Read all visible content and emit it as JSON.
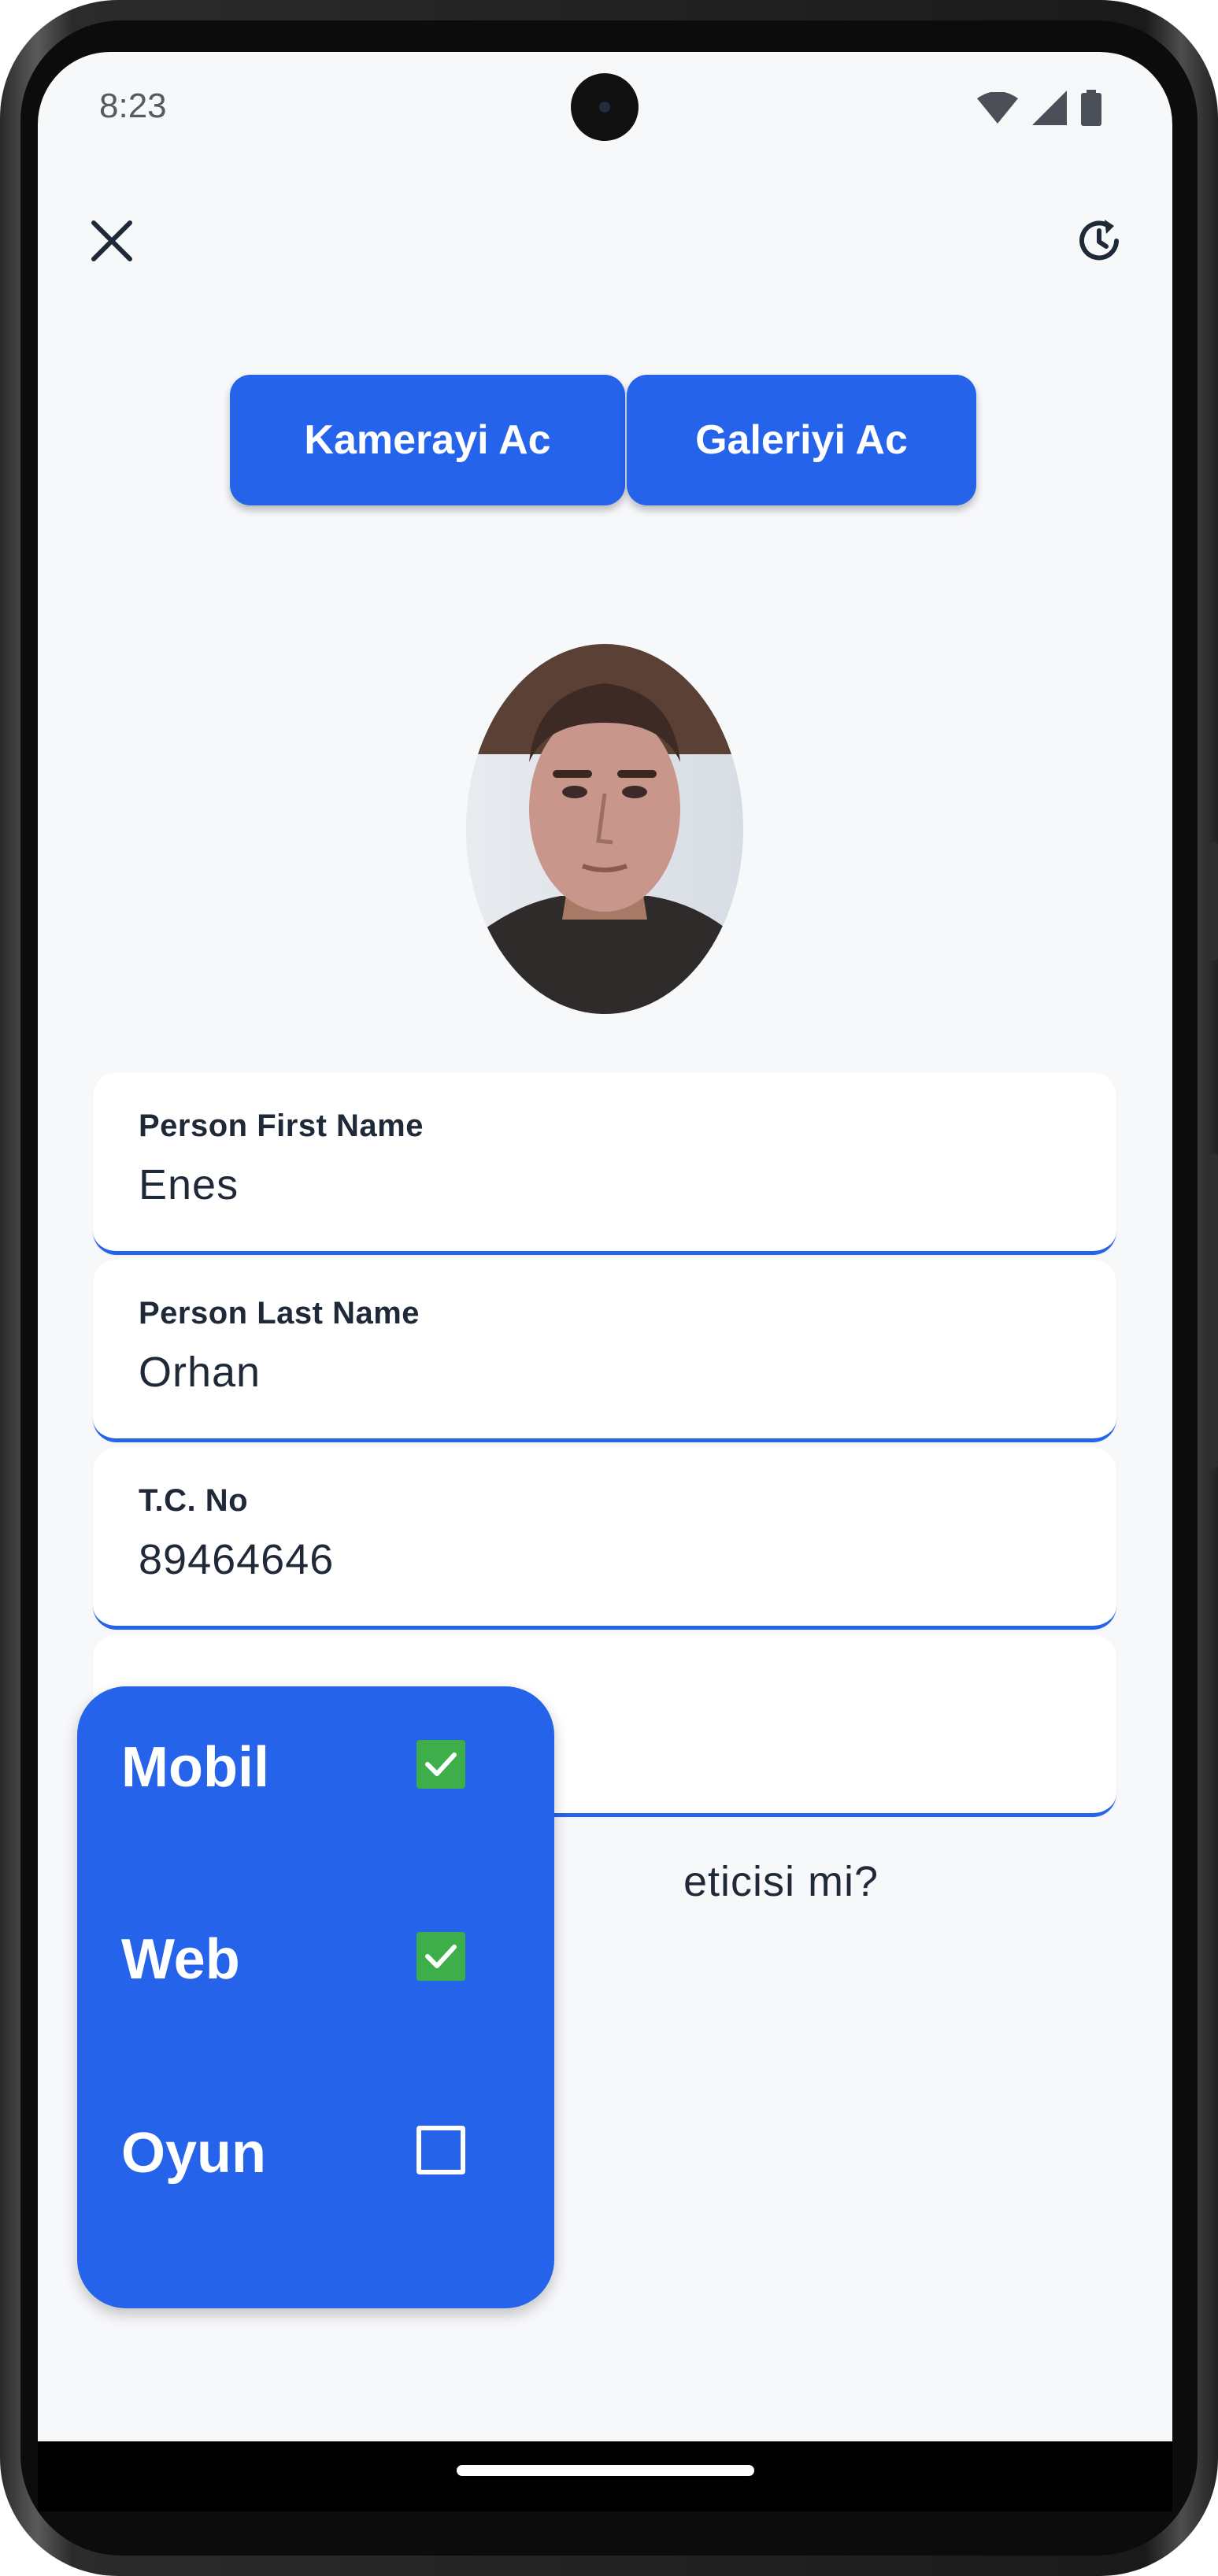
{
  "status_bar": {
    "time": "8:23"
  },
  "toolbar": {
    "close_icon": "close-icon",
    "history_icon": "history-refresh-icon"
  },
  "actions": {
    "camera_label": "Kamerayi Ac",
    "gallery_label": "Galeriyi Ac"
  },
  "form": {
    "fields": [
      {
        "label": "Person First Name",
        "value": "Enes"
      },
      {
        "label": "Person Last Name",
        "value": "Orhan"
      },
      {
        "label": "T.C. No",
        "value": "89464646"
      },
      {
        "label": "",
        "value": ""
      }
    ],
    "question_partial": "eticisi mi?"
  },
  "popup_menu": {
    "items": [
      {
        "label": "Mobil",
        "checked": true
      },
      {
        "label": "Web",
        "checked": true
      },
      {
        "label": "Oyun",
        "checked": false
      }
    ]
  },
  "colors": {
    "primary": "#2563eb",
    "check": "#3dae4a",
    "background": "#f7f8fa"
  }
}
